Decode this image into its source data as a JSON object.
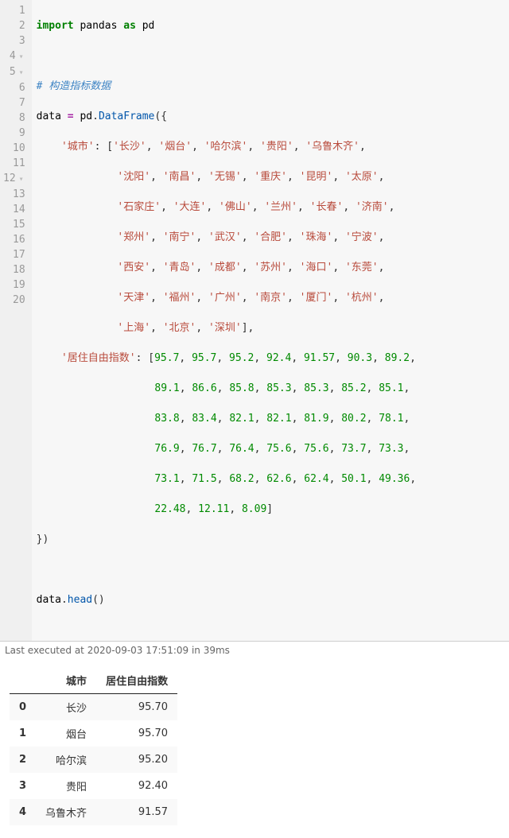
{
  "code": {
    "line1": {
      "import": "import",
      "pandas": "pandas",
      "as": "as",
      "pd": "pd"
    },
    "line3_comment": "# 构造指标数据",
    "line4": {
      "data": "data",
      "eq": "=",
      "pd": "pd",
      "DataFrame": "DataFrame",
      "open": "({"
    },
    "line5": {
      "key": "'城市'",
      "vals": [
        "'长沙'",
        "'烟台'",
        "'哈尔滨'",
        "'贵阳'",
        "'乌鲁木齐'"
      ]
    },
    "line6": {
      "vals": [
        "'沈阳'",
        "'南昌'",
        "'无锡'",
        "'重庆'",
        "'昆明'",
        "'太原'"
      ]
    },
    "line7": {
      "vals": [
        "'石家庄'",
        "'大连'",
        "'佛山'",
        "'兰州'",
        "'长春'",
        "'济南'"
      ]
    },
    "line8": {
      "vals": [
        "'郑州'",
        "'南宁'",
        "'武汉'",
        "'合肥'",
        "'珠海'",
        "'宁波'"
      ]
    },
    "line9": {
      "vals": [
        "'西安'",
        "'青岛'",
        "'成都'",
        "'苏州'",
        "'海口'",
        "'东莞'"
      ]
    },
    "line10": {
      "vals": [
        "'天津'",
        "'福州'",
        "'广州'",
        "'南京'",
        "'厦门'",
        "'杭州'"
      ]
    },
    "line11": {
      "vals": [
        "'上海'",
        "'北京'",
        "'深圳'"
      ]
    },
    "line12": {
      "key": "'居住自由指数'",
      "vals": [
        "95.7",
        "95.7",
        "95.2",
        "92.4",
        "91.57",
        "90.3",
        "89.2"
      ]
    },
    "line13": {
      "vals": [
        "89.1",
        "86.6",
        "85.8",
        "85.3",
        "85.3",
        "85.2",
        "85.1"
      ]
    },
    "line14": {
      "vals": [
        "83.8",
        "83.4",
        "82.1",
        "82.1",
        "81.9",
        "80.2",
        "78.1"
      ]
    },
    "line15": {
      "vals": [
        "76.9",
        "76.7",
        "76.4",
        "75.6",
        "75.6",
        "73.7",
        "73.3"
      ]
    },
    "line16": {
      "vals": [
        "73.1",
        "71.5",
        "68.2",
        "62.6",
        "62.4",
        "50.1",
        "49.36"
      ]
    },
    "line17": {
      "vals": [
        "22.48",
        "12.11",
        "8.09"
      ],
      "close": "]"
    },
    "line18": "})",
    "line20": {
      "data": "data",
      "head": "head",
      "paren": "()"
    }
  },
  "status": "Last executed at 2020-09-03 17:51:09 in 39ms",
  "output": {
    "columns": [
      "城市",
      "居住自由指数"
    ],
    "rows": [
      {
        "idx": "0",
        "c0": "长沙",
        "c1": "95.70"
      },
      {
        "idx": "1",
        "c0": "烟台",
        "c1": "95.70"
      },
      {
        "idx": "2",
        "c0": "哈尔滨",
        "c1": "95.20"
      },
      {
        "idx": "3",
        "c0": "贵阳",
        "c1": "92.40"
      },
      {
        "idx": "4",
        "c0": "乌鲁木齐",
        "c1": "91.57"
      }
    ]
  },
  "chart_data": {
    "type": "table",
    "title": "data.head()",
    "columns": [
      "城市",
      "居住自由指数"
    ],
    "index": [
      0,
      1,
      2,
      3,
      4
    ],
    "series": [
      {
        "name": "城市",
        "values": [
          "长沙",
          "烟台",
          "哈尔滨",
          "贵阳",
          "乌鲁木齐"
        ]
      },
      {
        "name": "居住自由指数",
        "values": [
          95.7,
          95.7,
          95.2,
          92.4,
          91.57
        ]
      }
    ]
  }
}
